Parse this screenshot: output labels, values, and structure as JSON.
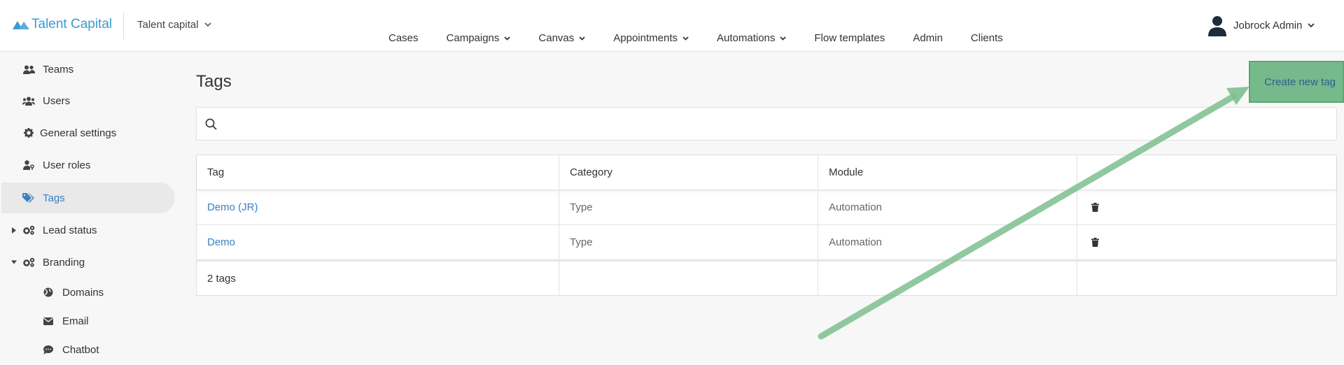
{
  "header": {
    "logo_text": "Talent Capital",
    "workspace": "Talent capital",
    "nav": [
      {
        "label": "Cases",
        "dropdown": false
      },
      {
        "label": "Campaigns",
        "dropdown": true
      },
      {
        "label": "Canvas",
        "dropdown": true
      },
      {
        "label": "Appointments",
        "dropdown": true
      },
      {
        "label": "Automations",
        "dropdown": true
      },
      {
        "label": "Flow templates",
        "dropdown": false
      },
      {
        "label": "Admin",
        "dropdown": false
      },
      {
        "label": "Clients",
        "dropdown": false
      }
    ],
    "user_name": "Jobrock Admin"
  },
  "sidebar": {
    "items": [
      {
        "label": "Teams",
        "icon": "users-icon"
      },
      {
        "label": "Users",
        "icon": "users-group-icon"
      },
      {
        "label": "General settings",
        "icon": "gear-icon"
      },
      {
        "label": "User roles",
        "icon": "user-key-icon"
      },
      {
        "label": "Tags",
        "icon": "tags-icon",
        "active": true
      },
      {
        "label": "Lead status",
        "icon": "gears-icon",
        "caret": "collapsed"
      },
      {
        "label": "Branding",
        "icon": "gears-icon",
        "caret": "expanded"
      },
      {
        "label": "Domains",
        "icon": "globe-icon",
        "sub": true
      },
      {
        "label": "Email",
        "icon": "envelope-icon",
        "sub": true
      },
      {
        "label": "Chatbot",
        "icon": "chat-icon",
        "sub": true
      }
    ]
  },
  "main": {
    "title": "Tags",
    "create_button": "Create new tag",
    "search": {
      "placeholder": "",
      "value": ""
    },
    "table": {
      "columns": [
        "Tag",
        "Category",
        "Module",
        ""
      ],
      "rows": [
        {
          "tag": "Demo (JR)",
          "category": "Type",
          "module": "Automation"
        },
        {
          "tag": "Demo",
          "category": "Type",
          "module": "Automation"
        }
      ],
      "footer": "2 tags"
    }
  },
  "colors": {
    "brand": "#3a9bd1",
    "link": "#3a7fc1",
    "annotation_arrow": "#7dbf8f"
  }
}
